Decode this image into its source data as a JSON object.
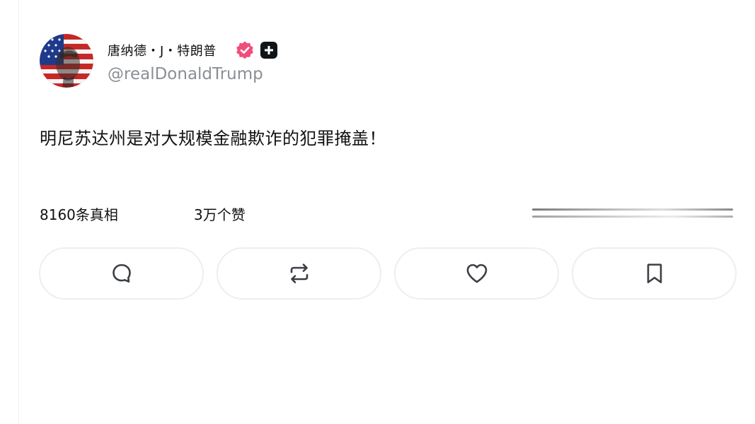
{
  "post": {
    "author": {
      "display_name": "唐纳德・J・特朗普",
      "handle": "@realDonaldTrump",
      "verified_icon": "verified-badge-icon",
      "plus_icon": "plus-badge-icon",
      "colors": {
        "verified": "#f04e7a",
        "plus_badge": "#0f1419",
        "handle": "#8a8f96"
      }
    },
    "text": "明尼苏达州是对大规模金融欺诈的犯罪掩盖！",
    "stats": {
      "truths": "8160条真相",
      "likes": "3万个赞"
    },
    "actions": [
      {
        "icon": "reply-icon"
      },
      {
        "icon": "retruth-icon"
      },
      {
        "icon": "like-icon"
      },
      {
        "icon": "bookmark-icon"
      }
    ]
  }
}
